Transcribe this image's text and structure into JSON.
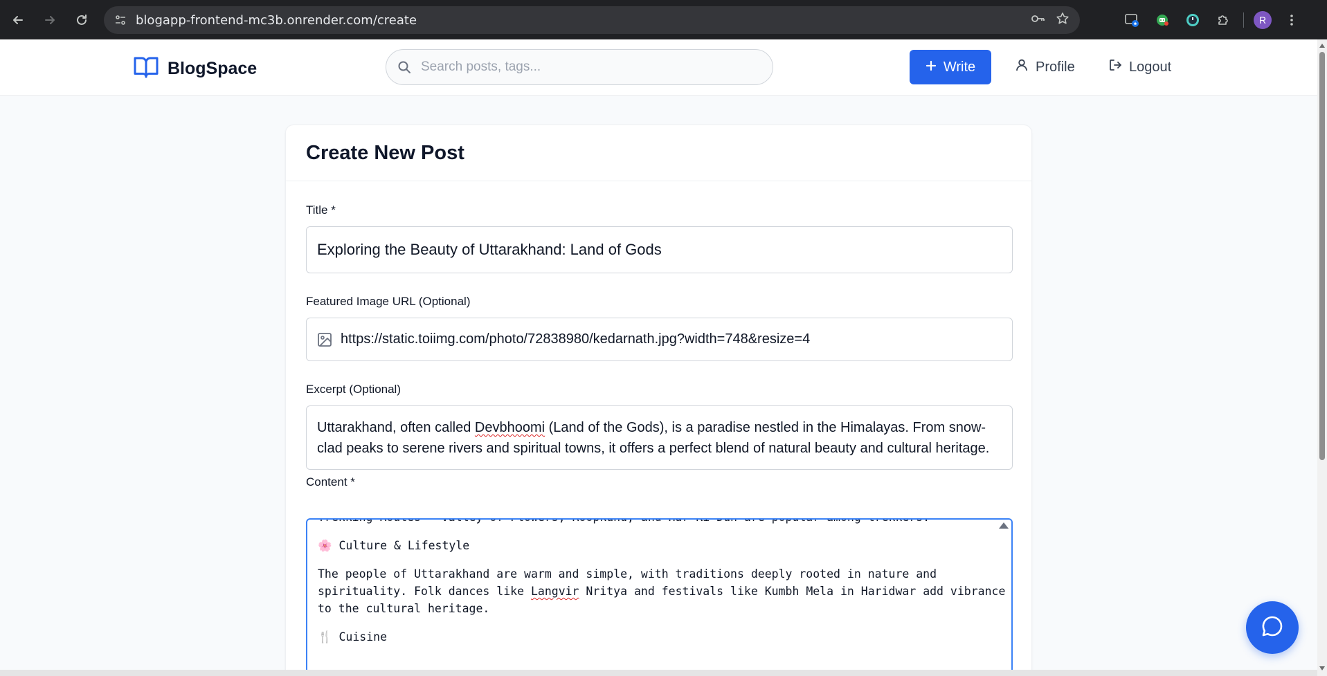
{
  "browser": {
    "url": "blogapp-frontend-mc3b.onrender.com/create",
    "profile_initial": "R"
  },
  "header": {
    "brand": "BlogSpace",
    "search_placeholder": "Search posts, tags...",
    "write_label": "Write",
    "profile_label": "Profile",
    "logout_label": "Logout"
  },
  "form": {
    "heading": "Create New Post",
    "title_label": "Title *",
    "title_value": "Exploring the Beauty of Uttarakhand: Land of Gods",
    "image_label": "Featured Image URL (Optional)",
    "image_value": "https://static.toiimg.com/photo/72838980/kedarnath.jpg?width=748&resize=4",
    "excerpt_label": "Excerpt (Optional)",
    "excerpt_before": "Uttarakhand, often called ",
    "excerpt_squiggle": "Devbhoomi",
    "excerpt_after": " (Land of the Gods), is a paradise nestled in the Himalayas. From snow-clad peaks to serene rivers and spiritual towns, it offers a perfect blend of natural beauty and cultural heritage.",
    "content_label": "Content *",
    "content": {
      "cut_line": "Trekking Routes – Valley of Flowers, Roopkund, and Har Ki Dun are popular among trekkers.",
      "culture_emoji": "🌸",
      "culture_heading": "Culture & Lifestyle",
      "culture_p1": "The people of Uttarakhand are warm and simple, with traditions deeply rooted in nature and",
      "culture_p2a": "spirituality. Folk dances like ",
      "culture_p2_squiggle": "Langvir",
      "culture_p2b": " Nritya and festivals like Kumbh Mela in Haridwar add vibrance",
      "culture_p3": "to the cultural heritage.",
      "cuisine_emoji": "🍴",
      "cuisine_heading": "Cuisine"
    }
  },
  "colors": {
    "primary": "#2563eb",
    "focus_border": "#3b82f6",
    "chrome_bg": "#202124"
  }
}
